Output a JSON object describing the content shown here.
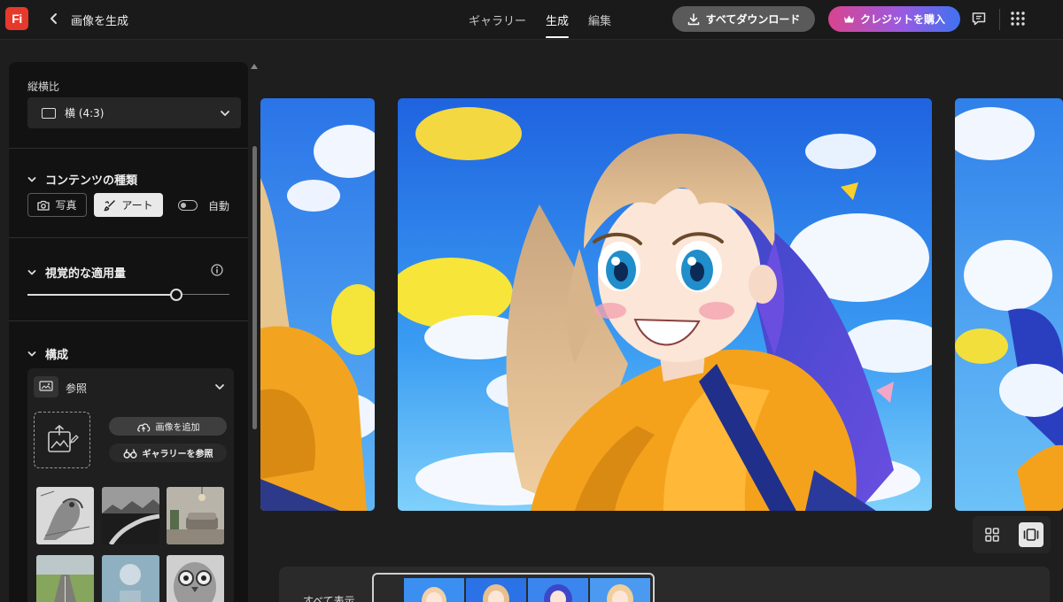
{
  "header": {
    "app_logo": "Fi",
    "title": "画像を生成",
    "tabs": [
      {
        "label": "ギャラリー",
        "active": false
      },
      {
        "label": "生成",
        "active": true
      },
      {
        "label": "編集",
        "active": false
      }
    ],
    "download_label": "すべてダウンロード",
    "credit_label": "クレジットを購入"
  },
  "panel": {
    "aspect": {
      "label": "縦横比",
      "value": "横 (4:3)"
    },
    "content_type": {
      "label": "コンテンツの種類",
      "photo": "写真",
      "art": "アート",
      "auto": "自動",
      "selected": "art",
      "auto_on": false
    },
    "visual_intensity": {
      "label": "視覚的な適用量",
      "value_percent": 74
    },
    "composition": {
      "label": "構成",
      "reference_label": "参照",
      "add_image": "画像を追加",
      "browse_gallery": "ギャラリーを参照"
    }
  },
  "canvas": {
    "show_all": "すべて表示",
    "view_mode": "single"
  },
  "colors": {
    "accent_red": "#e6392b",
    "credit_gradient_start": "#d9448f",
    "credit_gradient_end": "#3f72f0",
    "sky_blue": "#2f8cf0",
    "hoodie_yellow": "#f4a21c"
  }
}
